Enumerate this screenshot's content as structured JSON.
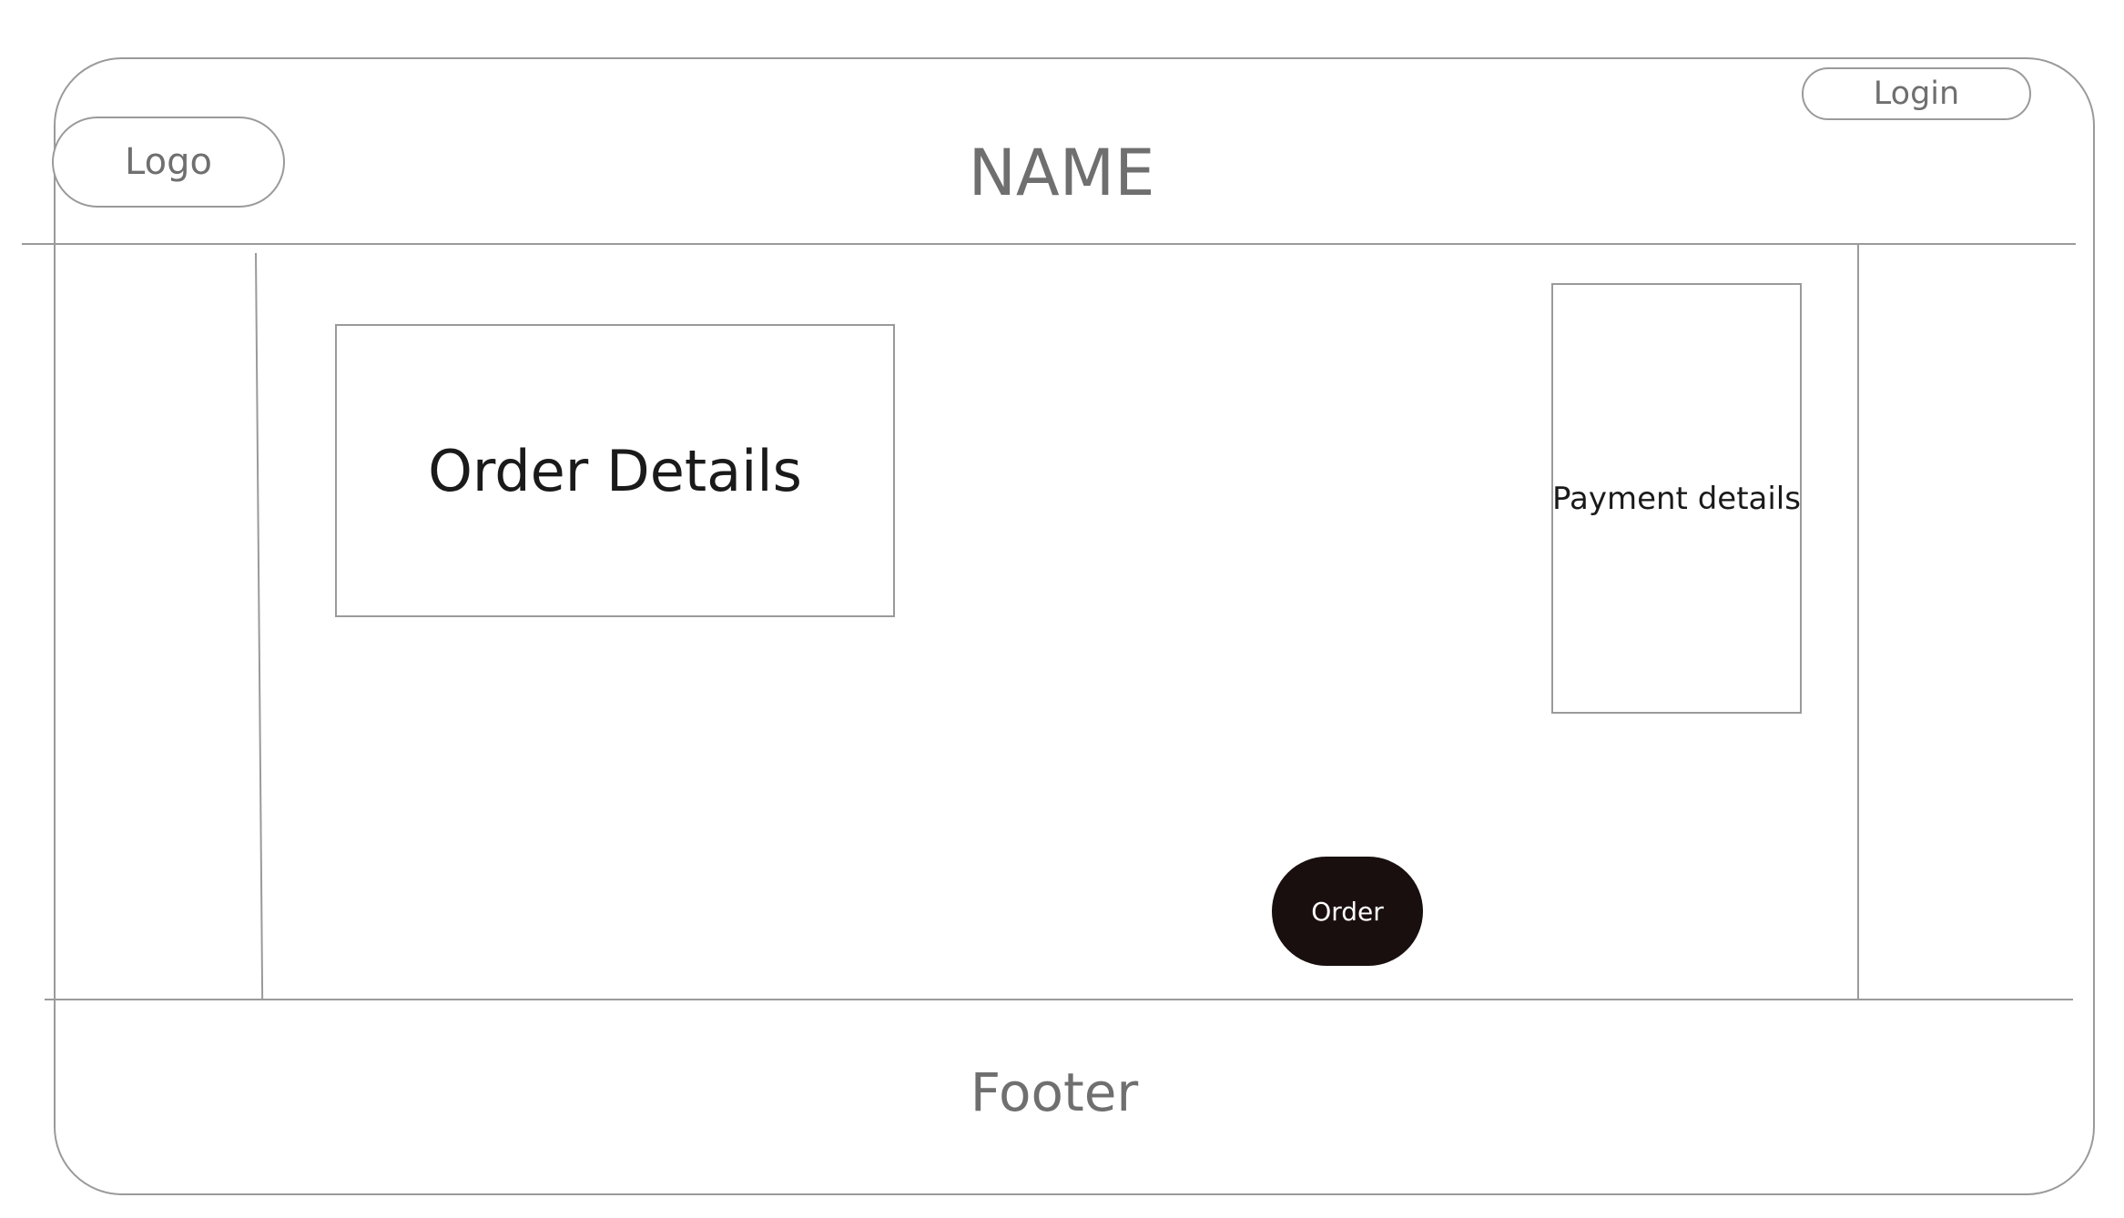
{
  "header": {
    "logo_label": "Logo",
    "site_name": "NAME",
    "login_label": "Login"
  },
  "main": {
    "order_details_label": "Order Details",
    "payment_details_label": "Payment details",
    "order_button_label": "Order"
  },
  "footer": {
    "label": "Footer"
  },
  "colors": {
    "outline": "#9a9a9a",
    "muted_text": "#6f6f6f",
    "primary_button": "#1a0f0f",
    "button_text": "#ffffff"
  }
}
